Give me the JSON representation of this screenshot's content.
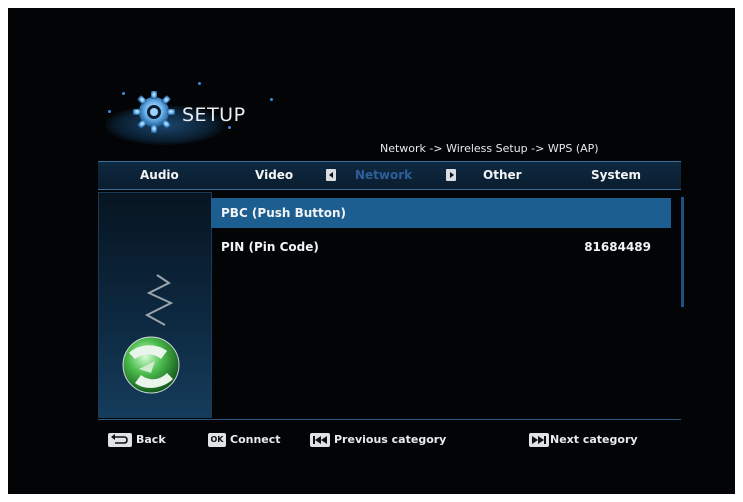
{
  "header": {
    "title": "SETUP",
    "breadcrumb": "Network -> Wireless Setup -> WPS (AP)"
  },
  "tabs": [
    {
      "label": "Audio",
      "active": false
    },
    {
      "label": "Video",
      "active": false
    },
    {
      "label": "Network",
      "active": true
    },
    {
      "label": "Other",
      "active": false
    },
    {
      "label": "System",
      "active": false
    }
  ],
  "menu": {
    "items": [
      {
        "label": "PBC (Push Button)",
        "value": "",
        "selected": true
      },
      {
        "label": "PIN (Pin Code)",
        "value": "81684489",
        "selected": false
      }
    ]
  },
  "footer": {
    "back_label": "Back",
    "ok_key": "OK",
    "connect_label": "Connect",
    "prev_label": "Previous category",
    "next_label": "Next category"
  },
  "colors": {
    "background": "#030405",
    "highlight": "#1d5e91",
    "active_tab": "#2e5f99",
    "text": "#f1f3f5"
  },
  "icons": [
    "gear-icon",
    "globe-icon",
    "arrow-left-icon",
    "arrow-right-icon",
    "back-icon",
    "prev-icon",
    "next-icon"
  ]
}
